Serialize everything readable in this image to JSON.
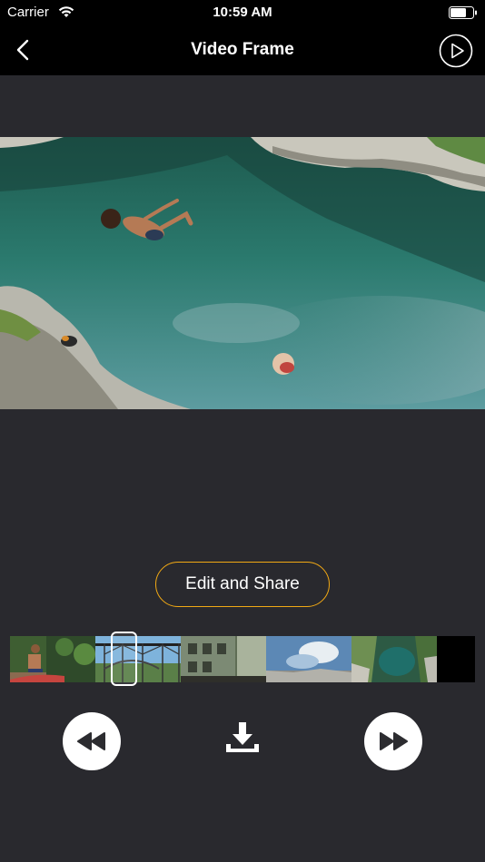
{
  "status_bar": {
    "carrier": "Carrier",
    "time": "10:59 AM",
    "icons": [
      "wifi-icon",
      "battery-icon"
    ]
  },
  "nav": {
    "title": "Video Frame",
    "back_icon": "chevron-left-icon",
    "play_icon": "play-circle-icon"
  },
  "main": {
    "edit_share_label": "Edit and Share"
  },
  "filmstrip": {
    "thumbnails": [
      "frame-1",
      "frame-2",
      "frame-3",
      "frame-4",
      "frame-5"
    ],
    "selected_index": 1
  },
  "controls": {
    "rewind_icon": "rewind-icon",
    "download_icon": "download-icon",
    "forward_icon": "fast-forward-icon"
  },
  "colors": {
    "background": "#29292e",
    "bar": "#000000",
    "accent": "#f2a914"
  }
}
